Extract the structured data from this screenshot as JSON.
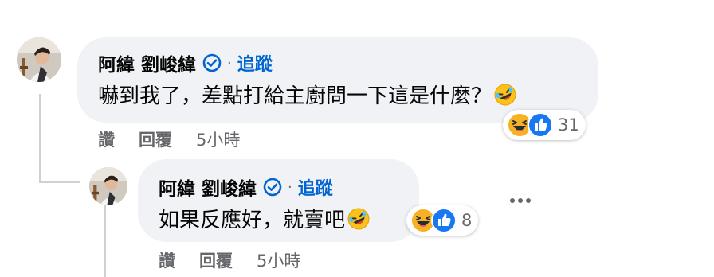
{
  "comment": {
    "author": "阿緯 劉峻緯",
    "dot": "·",
    "follow_label": "追蹤",
    "text": "嚇到我了，差點打給主廚問一下這是什麼？",
    "reaction_count": "31",
    "reactions": [
      "haha",
      "like"
    ],
    "actions": {
      "like": "讚",
      "reply": "回覆",
      "time": "5小時"
    }
  },
  "reply": {
    "author": "阿緯 劉峻緯",
    "dot": "·",
    "follow_label": "追蹤",
    "text": "如果反應好，就賣吧",
    "reaction_count": "8",
    "reactions": [
      "haha",
      "like"
    ],
    "actions": {
      "like": "讚",
      "reply": "回覆",
      "time": "5小時"
    }
  },
  "colors": {
    "bubble": "#f0f2f5",
    "follow": "#0064d1",
    "secondary_text": "#65676b",
    "like_blue": "#1877f2",
    "haha_yellow": "#f7b125"
  },
  "icons": {
    "verified": "verified-badge-icon",
    "more": "more-options-icon",
    "haha": "haha-reaction-icon",
    "like": "like-reaction-icon"
  }
}
